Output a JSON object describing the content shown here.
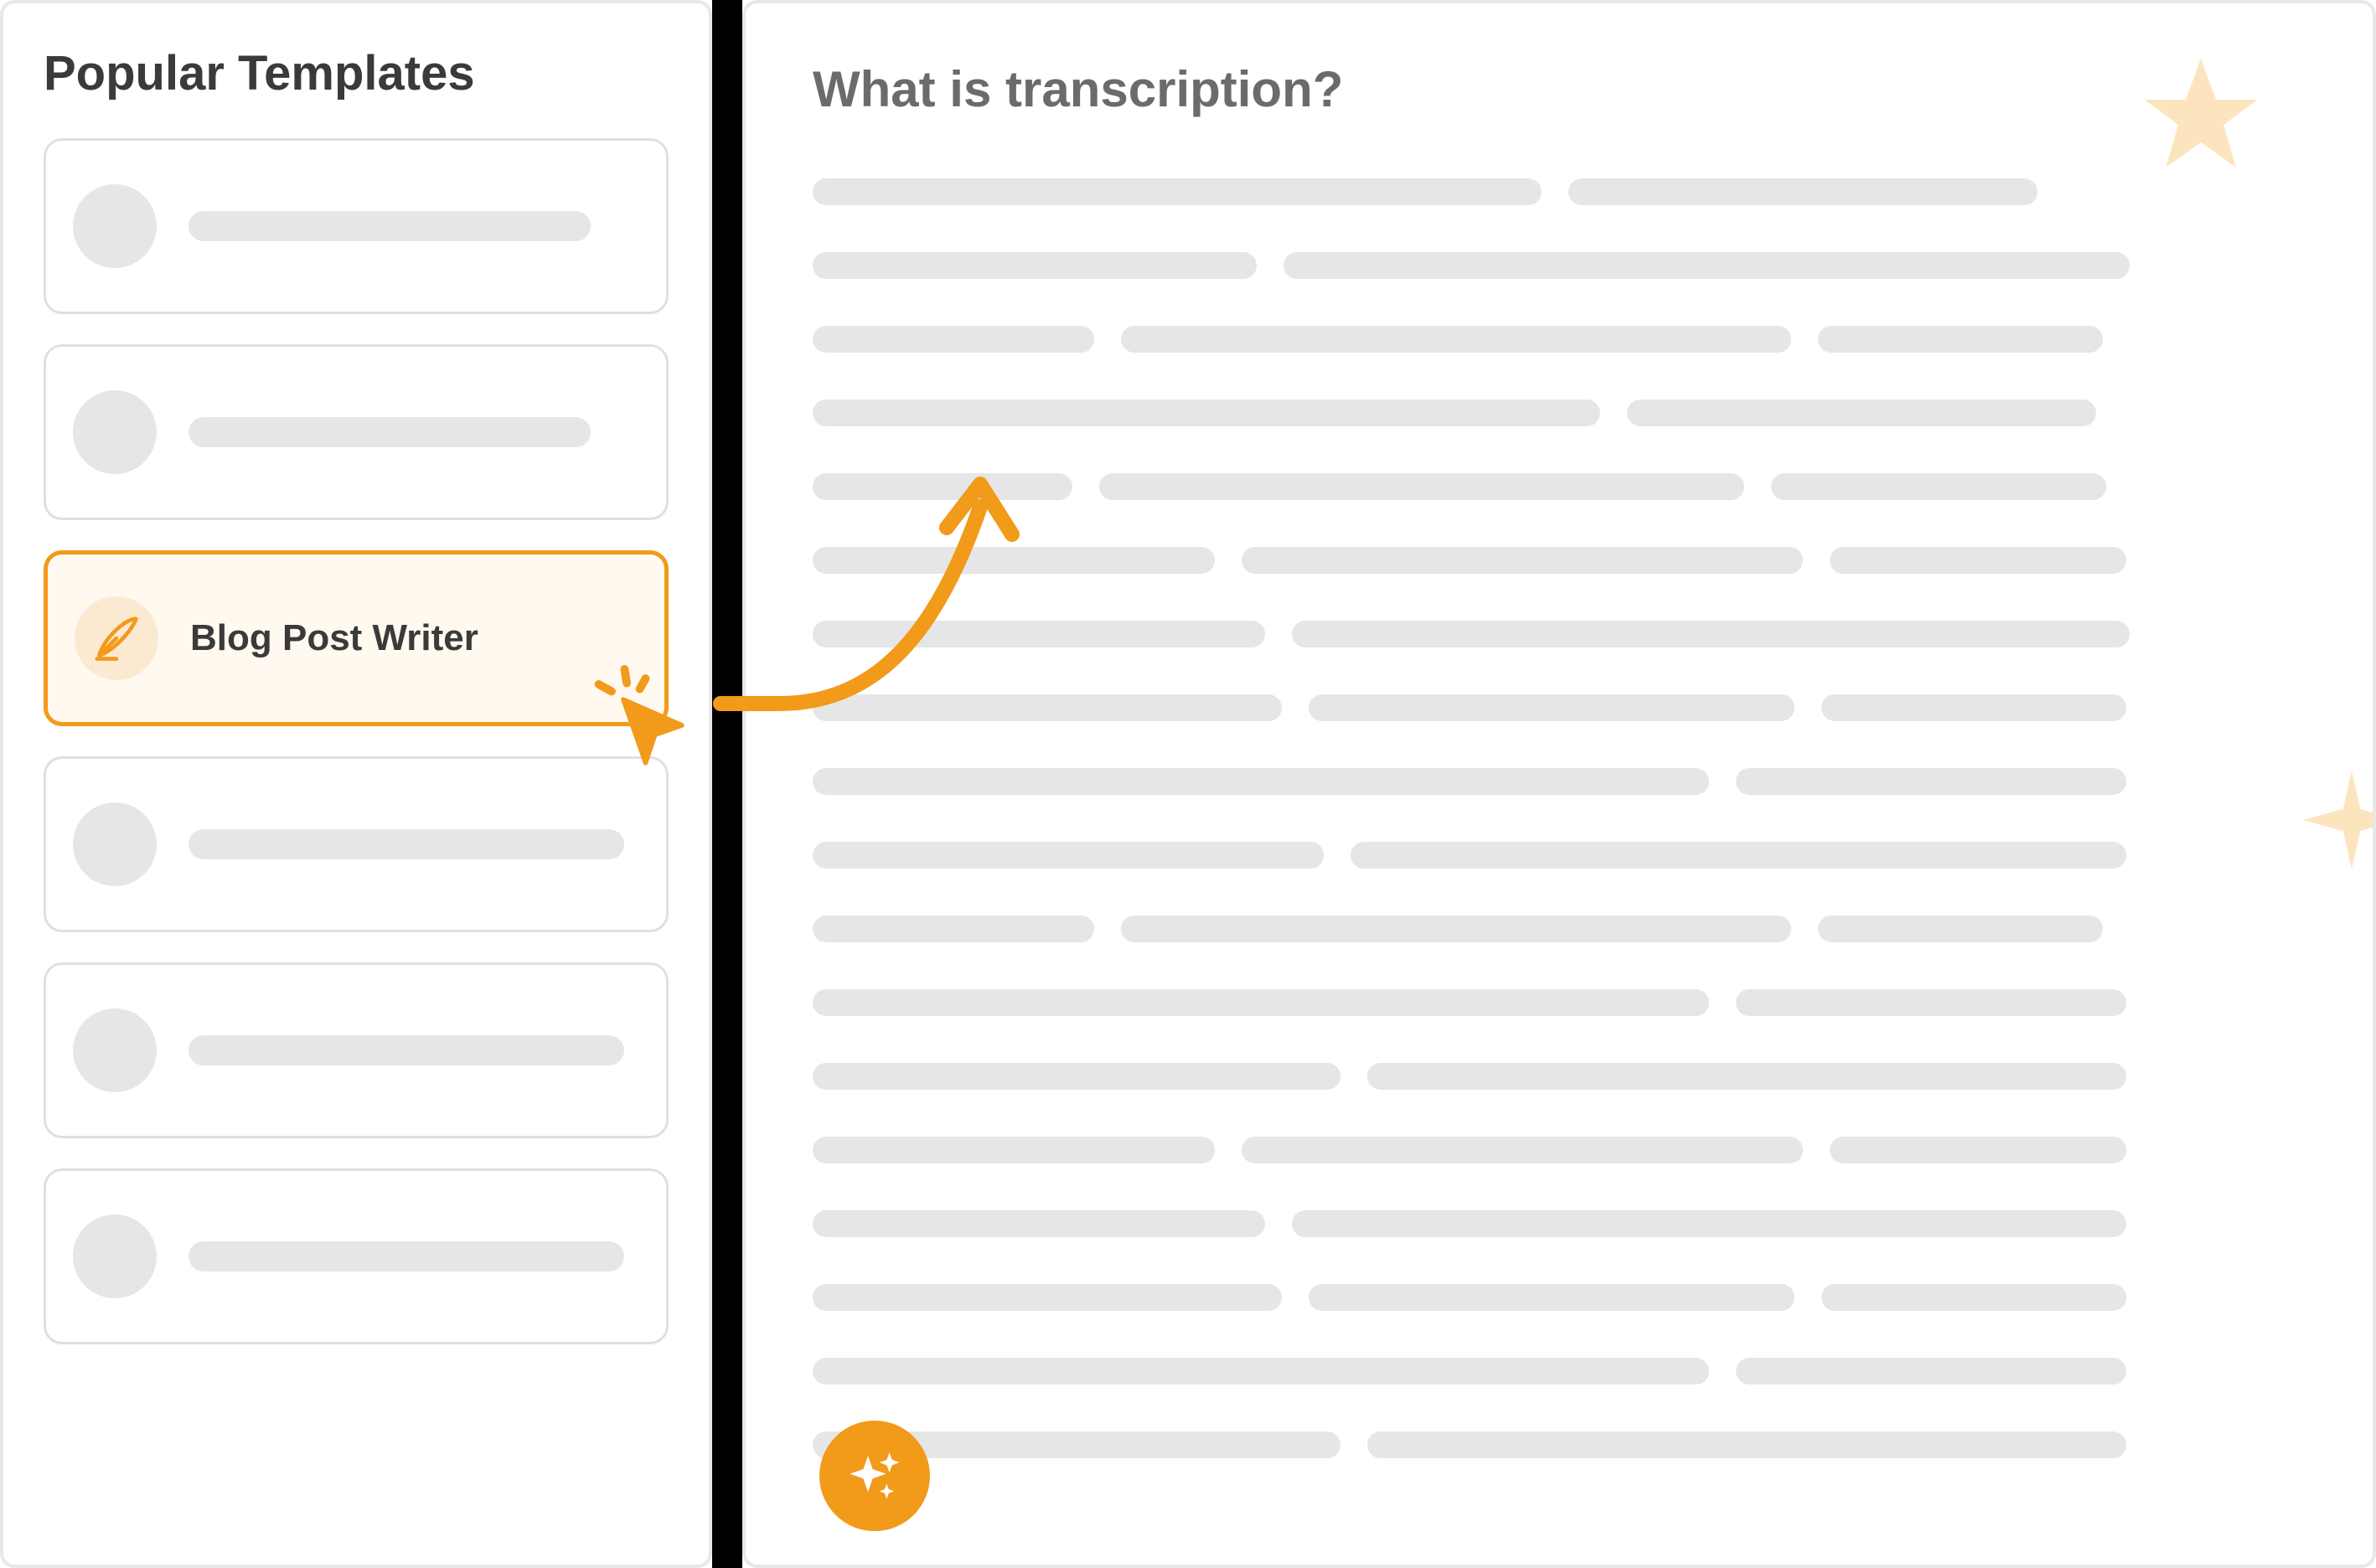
{
  "sidebar": {
    "title": "Popular Templates",
    "templates": [
      {
        "label": "",
        "selected": false
      },
      {
        "label": "",
        "selected": false
      },
      {
        "label": "Blog Post Writer",
        "selected": true
      },
      {
        "label": "",
        "selected": false
      },
      {
        "label": "",
        "selected": false
      },
      {
        "label": "",
        "selected": false
      }
    ]
  },
  "content": {
    "title": "What is transcription?"
  },
  "colors": {
    "accent": "#f29a1a",
    "accent_light": "#fce9d2",
    "placeholder": "#e6e6e6",
    "text_dark": "#3a3a3a",
    "text_muted": "#6b6b6b",
    "star_fill": "#fce5be"
  }
}
